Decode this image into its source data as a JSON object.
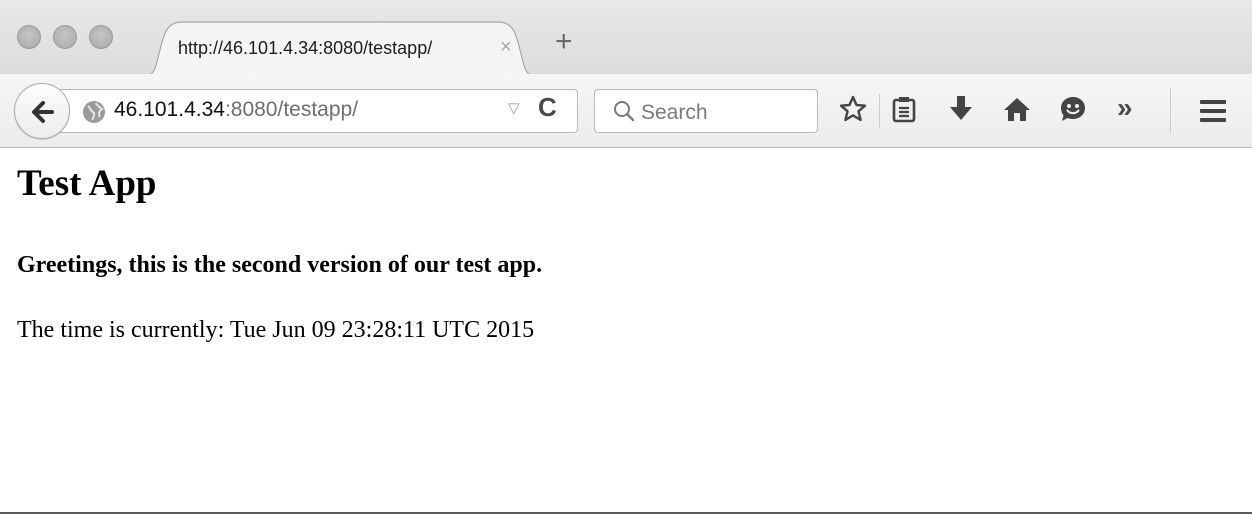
{
  "tab": {
    "title": "http://46.101.4.34:8080/testapp/",
    "close_glyph": "×",
    "new_tab_glyph": "+"
  },
  "urlbar": {
    "host": "46.101.4.34",
    "rest": ":8080/testapp/",
    "dropdown_glyph": "▽",
    "reload_glyph": "C"
  },
  "search": {
    "placeholder": "Search"
  },
  "toolbar": {
    "icons": [
      "bookmark-star-icon",
      "reading-list-icon",
      "downloads-icon",
      "home-icon",
      "hello-chat-icon",
      "overflow-chevron-icon",
      "hamburger-menu-icon"
    ],
    "overflow_glyph": "»"
  },
  "page": {
    "heading": "Test App",
    "subheading": "Greetings, this is the second version of our test app.",
    "time_text": "The time is currently: Tue Jun 09 23:28:11 UTC 2015"
  }
}
